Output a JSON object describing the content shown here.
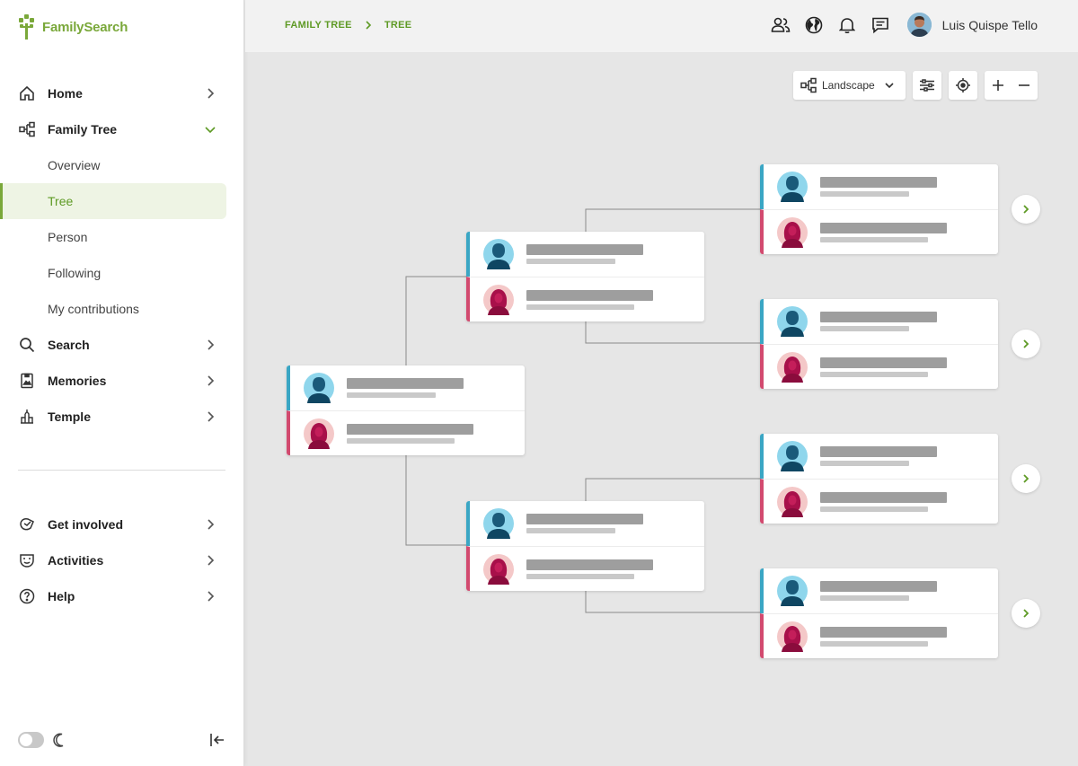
{
  "app": {
    "logo_text": "FamilySearch"
  },
  "sidebar": {
    "items": [
      {
        "label": "Home"
      },
      {
        "label": "Family Tree"
      },
      {
        "label": "Search"
      },
      {
        "label": "Memories"
      },
      {
        "label": "Temple"
      }
    ],
    "family_tree_sub": [
      {
        "label": "Overview"
      },
      {
        "label": "Tree"
      },
      {
        "label": "Person"
      },
      {
        "label": "Following"
      },
      {
        "label": "My contributions"
      }
    ],
    "secondary": [
      {
        "label": "Get involved"
      },
      {
        "label": "Activities"
      },
      {
        "label": "Help"
      }
    ]
  },
  "header": {
    "breadcrumb": [
      "FAMILY TREE",
      "TREE"
    ],
    "user_name": "Luis Quispe Tello"
  },
  "toolbar": {
    "layout_label": "Landscape"
  },
  "colors": {
    "brand": "#7aa83a",
    "male": "#3aa6c4",
    "female": "#d24a6f"
  },
  "icons": [
    "home-icon",
    "tree-icon",
    "search-icon",
    "memories-icon",
    "temple-icon",
    "get-involved-icon",
    "activities-icon",
    "help-icon",
    "people-icon",
    "globe-icon",
    "bell-icon",
    "chat-icon",
    "moon-icon",
    "collapse-icon",
    "sliders-icon",
    "target-icon",
    "plus-icon",
    "minus-icon",
    "chevron-right-icon"
  ]
}
